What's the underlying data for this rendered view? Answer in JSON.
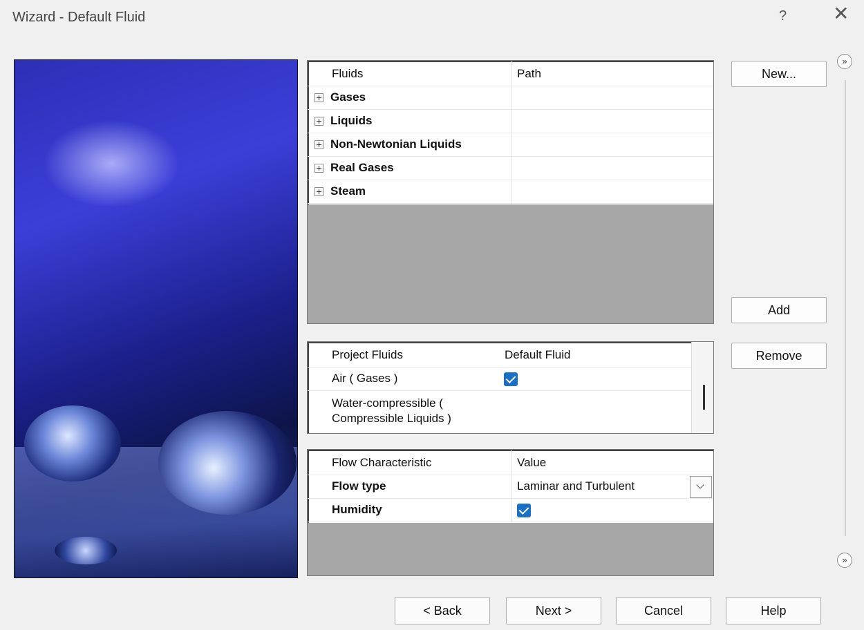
{
  "window": {
    "title": "Wizard - Default Fluid",
    "help_symbol": "?",
    "close_symbol": "✕"
  },
  "fluids_grid": {
    "headers": [
      "Fluids",
      "Path"
    ],
    "rows": [
      {
        "label": "Gases"
      },
      {
        "label": "Liquids"
      },
      {
        "label": "Non-Newtonian Liquids"
      },
      {
        "label": "Real Gases"
      },
      {
        "label": "Steam"
      }
    ]
  },
  "project_grid": {
    "headers": [
      "Project Fluids",
      "Default Fluid"
    ],
    "rows": [
      {
        "name": "Air ( Gases )",
        "default": true
      },
      {
        "name_line1": "Water-compressible (",
        "name_line2": "Compressible Liquids )",
        "default": false
      }
    ]
  },
  "flow_grid": {
    "headers": [
      "Flow Characteristic",
      "Value"
    ],
    "rows": [
      {
        "label": "Flow type",
        "value": "Laminar and Turbulent"
      },
      {
        "label": "Humidity",
        "checked": true
      }
    ]
  },
  "buttons": {
    "new": "New...",
    "add": "Add",
    "remove": "Remove",
    "back": "< Back",
    "next": "Next >",
    "cancel": "Cancel",
    "help": "Help"
  },
  "side_nav": {
    "up_symbol": "»",
    "down_symbol": "»"
  },
  "colors": {
    "check_blue": "#1a6fc6",
    "gray_area": "#a7a7a7"
  }
}
